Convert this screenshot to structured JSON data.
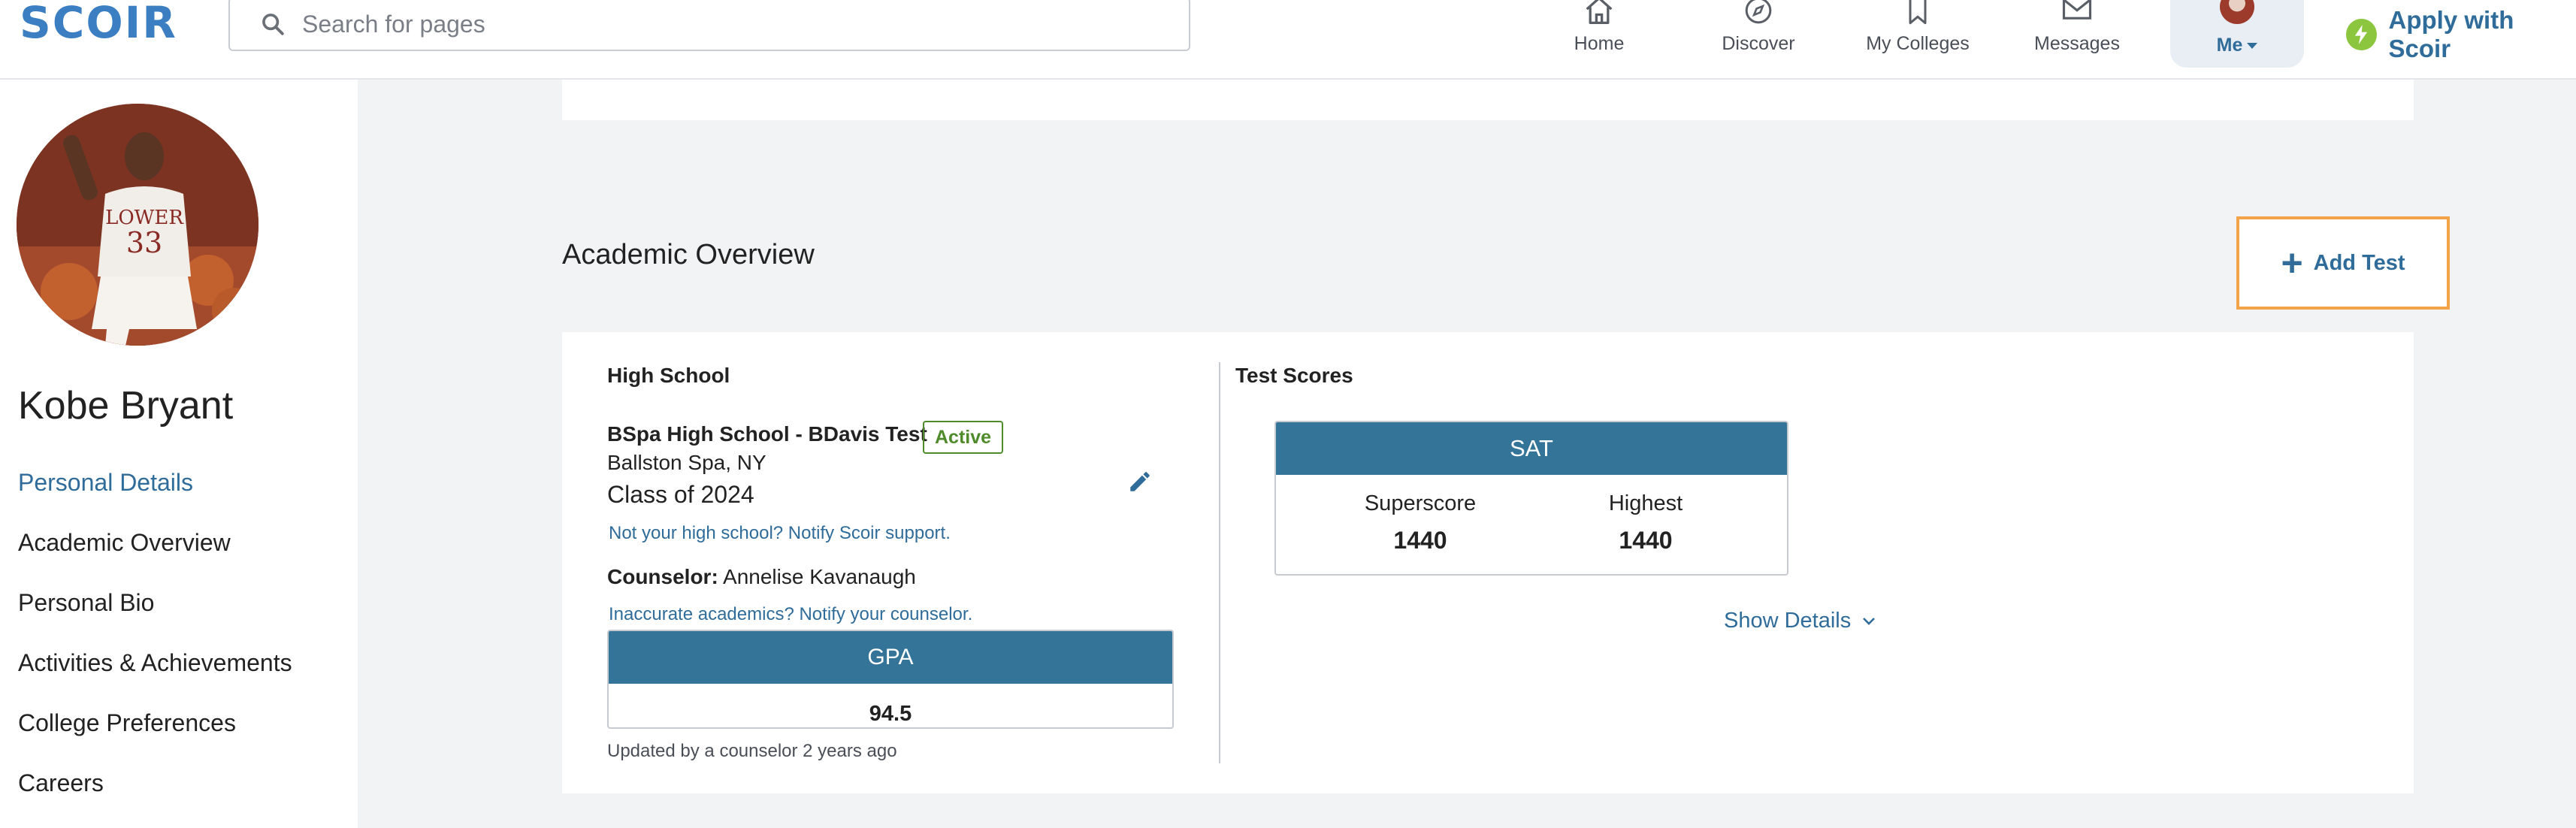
{
  "header": {
    "logo": "SCOIR",
    "search_placeholder": "Search for pages",
    "nav": [
      {
        "label": "Home",
        "icon": "home-icon"
      },
      {
        "label": "Discover",
        "icon": "compass-icon"
      },
      {
        "label": "My Colleges",
        "icon": "bookmark-icon"
      },
      {
        "label": "Messages",
        "icon": "envelope-icon"
      }
    ],
    "me_label": "Me",
    "apply_label": "Apply with Scoir"
  },
  "sidebar": {
    "name": "Kobe Bryant",
    "items": [
      {
        "label": "Personal Details",
        "active": true
      },
      {
        "label": "Academic Overview",
        "active": false
      },
      {
        "label": "Personal Bio",
        "active": false
      },
      {
        "label": "Activities & Achievements",
        "active": false
      },
      {
        "label": "College Preferences",
        "active": false
      },
      {
        "label": "Careers",
        "active": false
      }
    ]
  },
  "academic": {
    "title": "Academic Overview",
    "add_test_label": "Add Test",
    "high_school": {
      "heading": "High School",
      "school_name": "BSpa High School - BDavis Test",
      "status": "Active",
      "location": "Ballston Spa, NY",
      "class_of": "Class of 2024",
      "notify_support": "Not your high school? Notify Scoir support.",
      "counselor_label": "Counselor:",
      "counselor_name": "Annelise Kavanaugh",
      "notify_counselor": "Inaccurate academics? Notify your counselor.",
      "gpa_label": "GPA",
      "gpa_value": "94.5",
      "updated": "Updated by a counselor 2 years ago"
    },
    "test_scores": {
      "heading": "Test Scores",
      "test_name": "SAT",
      "superscore_label": "Superscore",
      "superscore_value": "1440",
      "highest_label": "Highest",
      "highest_value": "1440",
      "show_details": "Show Details"
    }
  },
  "colors": {
    "brand": "#3b7fc2",
    "link": "#2f6c9a",
    "header_fill": "#357499",
    "active_badge": "#4f8a2b",
    "focus_outline": "#f5a34a",
    "apply_icon": "#8cc63f"
  }
}
